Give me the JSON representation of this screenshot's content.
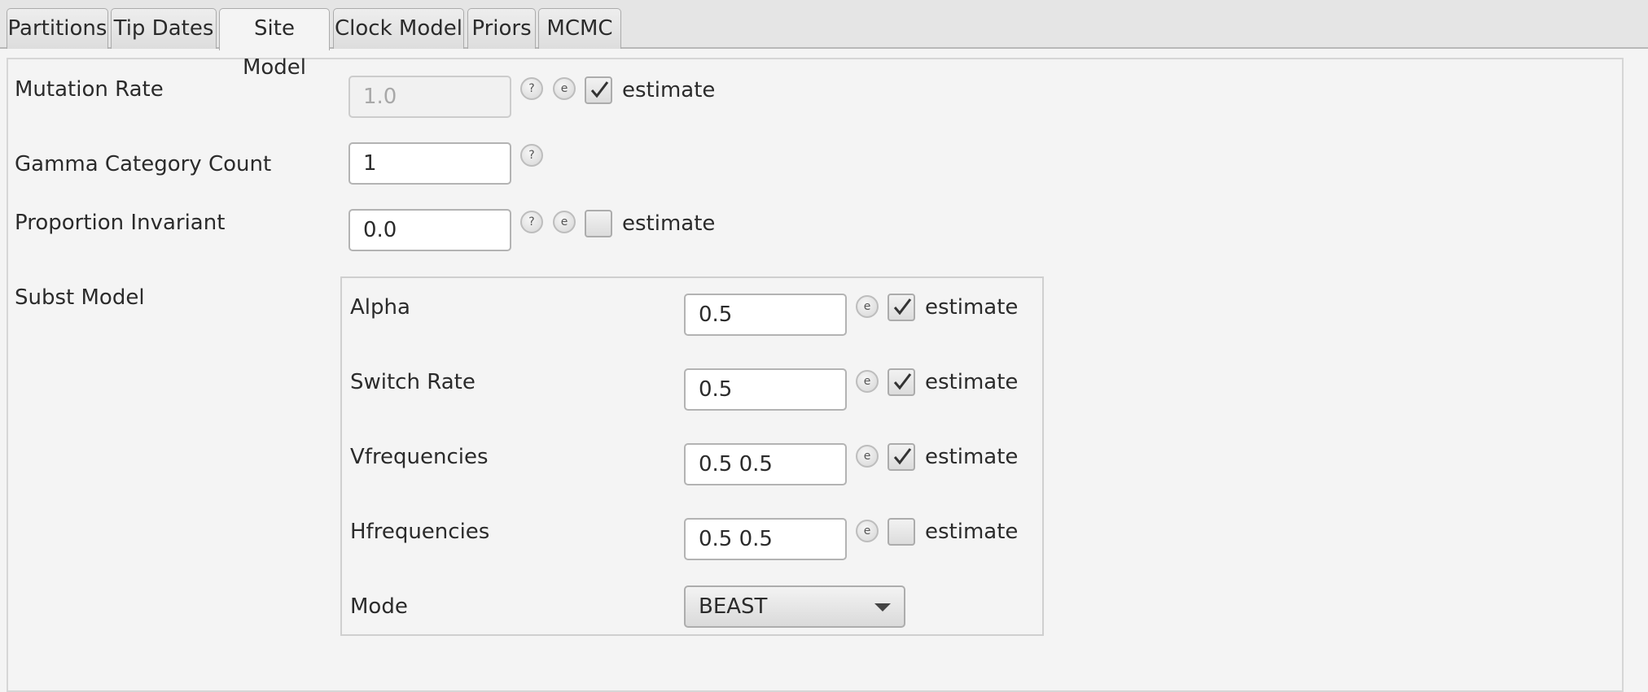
{
  "tabs": [
    {
      "label": "Partitions",
      "selected": false
    },
    {
      "label": "Tip Dates",
      "selected": false
    },
    {
      "label": "Site Model",
      "selected": true
    },
    {
      "label": "Clock Model",
      "selected": false
    },
    {
      "label": "Priors",
      "selected": false
    },
    {
      "label": "MCMC",
      "selected": false
    }
  ],
  "site_model": {
    "mutation_rate": {
      "label": "Mutation Rate",
      "value": "1.0",
      "enabled": false,
      "help": "?",
      "edit": "e",
      "estimate_label": "estimate",
      "estimate_checked": true
    },
    "gamma_category_count": {
      "label": "Gamma Category Count",
      "value": "1",
      "help": "?"
    },
    "proportion_invariant": {
      "label": "Proportion Invariant",
      "value": "0.0",
      "help": "?",
      "edit": "e",
      "estimate_label": "estimate",
      "estimate_checked": false
    },
    "subst_model": {
      "label": "Subst Model",
      "params": [
        {
          "label": "Alpha",
          "value": "0.5",
          "edit": "e",
          "estimate_label": "estimate",
          "estimate_checked": true
        },
        {
          "label": "Switch Rate",
          "value": "0.5",
          "edit": "e",
          "estimate_label": "estimate",
          "estimate_checked": true
        },
        {
          "label": "Vfrequencies",
          "value": "0.5 0.5",
          "edit": "e",
          "estimate_label": "estimate",
          "estimate_checked": true
        },
        {
          "label": "Hfrequencies",
          "value": "0.5 0.5",
          "edit": "e",
          "estimate_label": "estimate",
          "estimate_checked": false
        }
      ],
      "mode": {
        "label": "Mode",
        "value": "BEAST"
      }
    }
  }
}
